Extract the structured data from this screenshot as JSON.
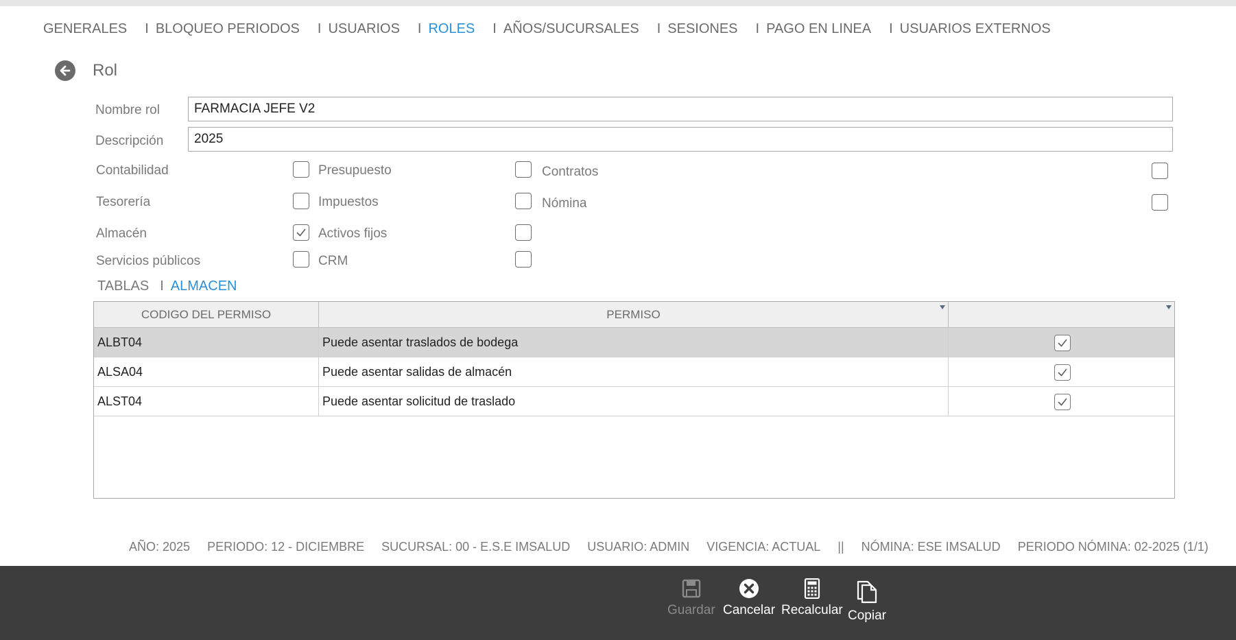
{
  "nav": {
    "items": [
      {
        "label": "GENERALES",
        "active": false
      },
      {
        "label": "BLOQUEO PERIODOS",
        "active": false
      },
      {
        "label": "USUARIOS",
        "active": false
      },
      {
        "label": "ROLES",
        "active": true
      },
      {
        "label": "AÑOS/SUCURSALES",
        "active": false
      },
      {
        "label": "SESIONES",
        "active": false
      },
      {
        "label": "PAGO EN LINEA",
        "active": false
      },
      {
        "label": "USUARIOS EXTERNOS",
        "active": false
      }
    ],
    "separator": "I"
  },
  "header": {
    "title": "Rol"
  },
  "form": {
    "name_label": "Nombre rol",
    "name_value": "FARMACIA JEFE V2",
    "desc_label": "Descripción",
    "desc_value": "2025"
  },
  "modules": {
    "contabilidad": "Contabilidad",
    "tesoreria": "Tesorería",
    "almacen": "Almacén",
    "servicios": "Servicios públicos",
    "presupuesto": "Presupuesto",
    "impuestos": "Impuestos",
    "activos": "Activos fijos",
    "crm": "CRM",
    "contratos": "Contratos",
    "nomina": "Nómina",
    "checked": {
      "contabilidad": false,
      "tesoreria": false,
      "almacen": true,
      "servicios": false,
      "presupuesto": false,
      "impuestos": false,
      "activos": false,
      "crm": false,
      "contratos": false,
      "nomina": false
    }
  },
  "subtabs": {
    "items": [
      {
        "label": "TABLAS",
        "active": false
      },
      {
        "label": "ALMACEN",
        "active": true
      }
    ],
    "separator": "I"
  },
  "grid": {
    "columns": [
      "CODIGO DEL PERMISO",
      "PERMISO",
      ""
    ],
    "rows": [
      {
        "code": "ALBT04",
        "permiso": "Puede asentar traslados de bodega",
        "checked": true,
        "selected": true
      },
      {
        "code": "ALSA04",
        "permiso": "Puede asentar salidas de almacén",
        "checked": true,
        "selected": false
      },
      {
        "code": "ALST04",
        "permiso": "Puede asentar solicitud de traslado",
        "checked": true,
        "selected": false
      }
    ]
  },
  "status": {
    "year": "AÑO: 2025",
    "period": "PERIODO: 12 - DICIEMBRE",
    "branch": "SUCURSAL: 00 - E.S.E IMSALUD",
    "user": "USUARIO: ADMIN",
    "validity": "VIGENCIA: ACTUAL",
    "divider": "||",
    "payroll": "NÓMINA: ESE IMSALUD",
    "payroll_period": "PERIODO NÓMINA: 02-2025 (1/1)"
  },
  "toolbar": {
    "save_label": "Guardar",
    "cancel_label": "Cancelar",
    "recalc_label": "Recalcular",
    "copy_label": "Copiar"
  },
  "colors": {
    "accent": "#2b8fd9",
    "toolbar_bg": "#3d3d3d",
    "selected_row": "#d6d6d6"
  }
}
